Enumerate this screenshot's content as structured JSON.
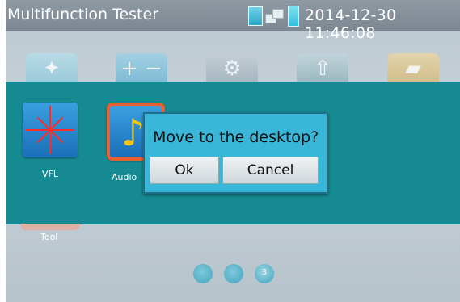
{
  "titlebar": {
    "app_title": "Multifunction Tester",
    "datetime": "2014-12-30 11:46:08"
  },
  "status_icons": [
    "signal-icon",
    "network-icon",
    "battery-icon"
  ],
  "background_icons": [
    "flashlight-icon",
    "plus-minus-icon",
    "gear-icon",
    "upload-icon",
    "folder-icon"
  ],
  "apps": [
    {
      "label": "VFL",
      "icon": "laser-icon"
    },
    {
      "label": "Audio",
      "icon": "music-note-icon"
    }
  ],
  "peek_app": {
    "label": "Tool"
  },
  "dialog": {
    "message": "Move to the desktop?",
    "ok_label": "Ok",
    "cancel_label": "Cancel"
  },
  "pager": {
    "current_page": "3",
    "total_pages": 3
  },
  "colors": {
    "panel": "#168a93",
    "dialog": "#39b6d8",
    "highlight": "#e9612f"
  }
}
